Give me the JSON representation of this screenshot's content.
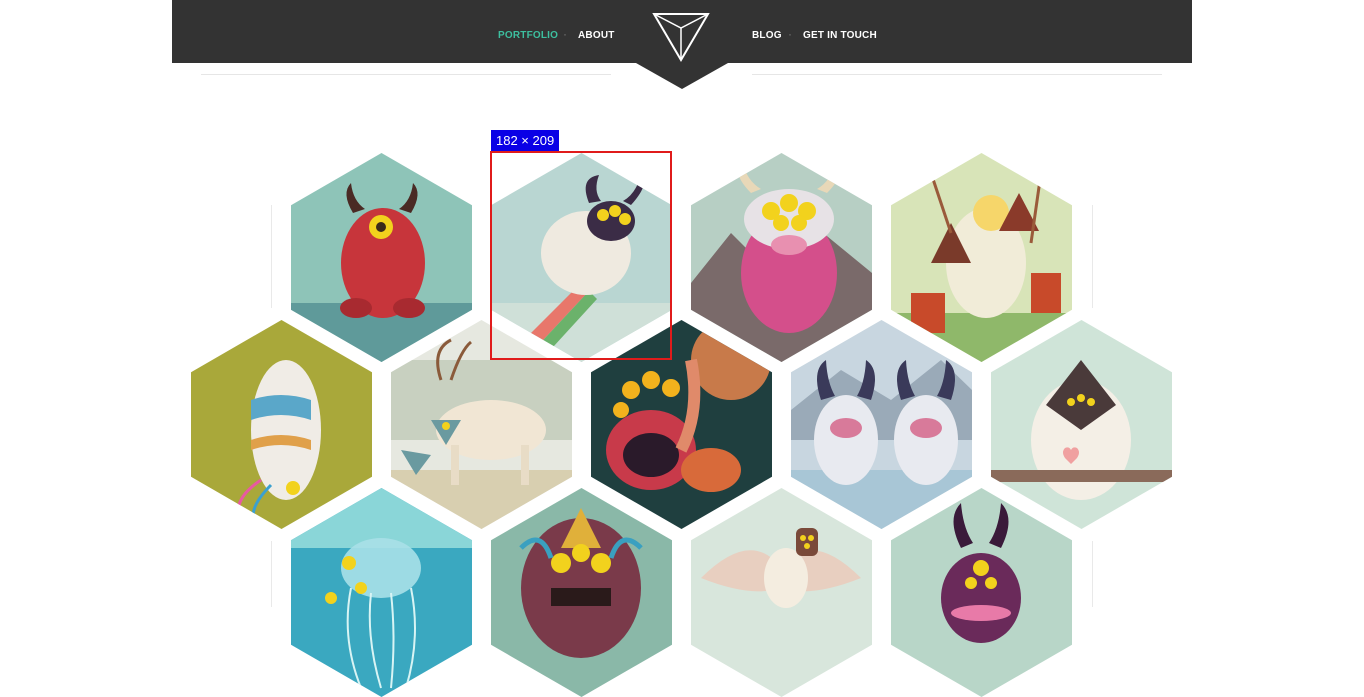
{
  "nav": {
    "left": [
      {
        "label": "PORTFOLIO",
        "active": true
      },
      {
        "label": "ABOUT",
        "active": false
      }
    ],
    "right": [
      {
        "label": "BLOG",
        "active": false
      },
      {
        "label": "GET IN TOUCH",
        "active": false
      }
    ],
    "separator": "·",
    "accent_color": "#3dbf9f",
    "bar_color": "#333333"
  },
  "logo": {
    "icon": "triangle-logo-icon"
  },
  "inspector": {
    "label": "182 × 209"
  },
  "portfolio": {
    "items": [
      {
        "name": "red-horned-monster"
      },
      {
        "name": "flying-sheep-monster"
      },
      {
        "name": "pink-cow-monster"
      },
      {
        "name": "yeti-with-bugs"
      },
      {
        "name": "unicorn-creature"
      },
      {
        "name": "antlered-deer-creature"
      },
      {
        "name": "octopus-eye-monster"
      },
      {
        "name": "two-yetis-in-water"
      },
      {
        "name": "hooded-yeti"
      },
      {
        "name": "jellyfish"
      },
      {
        "name": "tribal-mask-monster"
      },
      {
        "name": "bird-creature"
      },
      {
        "name": "purple-horned-monster"
      }
    ]
  }
}
